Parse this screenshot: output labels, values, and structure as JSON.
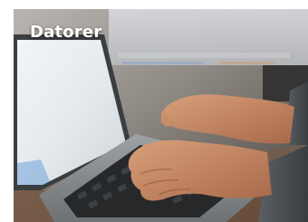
{
  "card": {
    "title": "Datorer",
    "image": "laptop-typing-photo"
  },
  "colors": {
    "title_text": "#ffffff"
  }
}
